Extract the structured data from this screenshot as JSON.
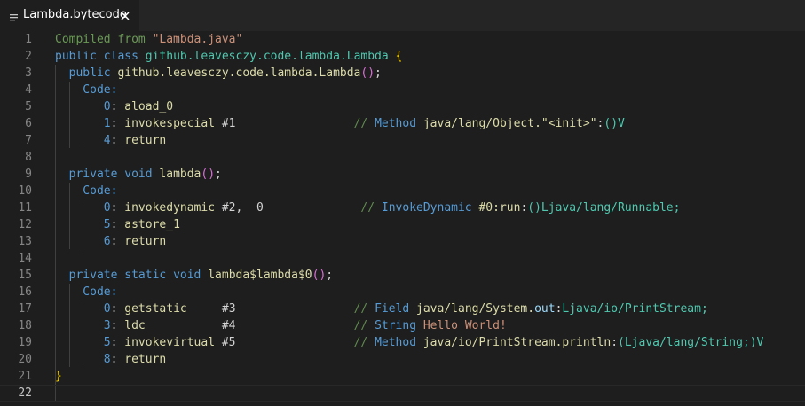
{
  "tab": {
    "title": "Lambda.bytecode",
    "icon": "lines-icon",
    "close": "close-icon"
  },
  "colors": {
    "background": "#1e1e1e",
    "tabbar": "#252526",
    "comment": "#6a9955",
    "string": "#ce9178",
    "keyword": "#569cd6",
    "type": "#4ec9b0",
    "function": "#dcdcaa",
    "bracket_gold": "#ffd700",
    "bracket_purple": "#da70d6"
  },
  "lines": [
    {
      "n": "1",
      "tokens": [
        {
          "t": "Compiled from ",
          "c": "c-comment"
        },
        {
          "t": "\"Lambda.java\"",
          "c": "c-str"
        }
      ]
    },
    {
      "n": "2",
      "tokens": [
        {
          "t": "public ",
          "c": "c-kw"
        },
        {
          "t": "class ",
          "c": "c-kw"
        },
        {
          "t": "github.leavesczy.code.lambda.Lambda",
          "c": "c-type"
        },
        {
          "t": " ",
          "c": "c-plain"
        },
        {
          "t": "{",
          "c": "c-br1"
        }
      ]
    },
    {
      "n": "3",
      "tokens": [
        {
          "t": "  public ",
          "c": "c-kw"
        },
        {
          "t": "github.leavesczy.code.lambda.Lambda",
          "c": "c-fn"
        },
        {
          "t": "(",
          "c": "c-br2"
        },
        {
          "t": ")",
          "c": "c-br2"
        },
        {
          "t": ";",
          "c": "c-plain"
        }
      ]
    },
    {
      "n": "4",
      "tokens": [
        {
          "t": "    Code:",
          "c": "c-kw"
        }
      ]
    },
    {
      "n": "5",
      "tokens": [
        {
          "t": "       0",
          "c": "c-kw"
        },
        {
          "t": ": ",
          "c": "c-plain"
        },
        {
          "t": "aload_0",
          "c": "c-fn"
        }
      ]
    },
    {
      "n": "6",
      "tokens": [
        {
          "t": "       1",
          "c": "c-kw"
        },
        {
          "t": ": ",
          "c": "c-plain"
        },
        {
          "t": "invokespecial",
          "c": "c-fn"
        },
        {
          "t": " #1                 ",
          "c": "c-plain"
        },
        {
          "t": "// ",
          "c": "c-lcom"
        },
        {
          "t": "Method",
          "c": "c-lcomkw"
        },
        {
          "t": " java/lang/Object.",
          "c": "c-fn"
        },
        {
          "t": "\"<init>\"",
          "c": "c-fn"
        },
        {
          "t": ":",
          "c": "c-plain"
        },
        {
          "t": "()V",
          "c": "c-type"
        }
      ]
    },
    {
      "n": "7",
      "tokens": [
        {
          "t": "       4",
          "c": "c-kw"
        },
        {
          "t": ": ",
          "c": "c-plain"
        },
        {
          "t": "return",
          "c": "c-fn"
        }
      ]
    },
    {
      "n": "8",
      "tokens": []
    },
    {
      "n": "9",
      "tokens": [
        {
          "t": "  private ",
          "c": "c-kw"
        },
        {
          "t": "void ",
          "c": "c-kw"
        },
        {
          "t": "lambda",
          "c": "c-fn"
        },
        {
          "t": "(",
          "c": "c-br2"
        },
        {
          "t": ")",
          "c": "c-br2"
        },
        {
          "t": ";",
          "c": "c-plain"
        }
      ]
    },
    {
      "n": "10",
      "tokens": [
        {
          "t": "    Code:",
          "c": "c-kw"
        }
      ]
    },
    {
      "n": "11",
      "tokens": [
        {
          "t": "       0",
          "c": "c-kw"
        },
        {
          "t": ": ",
          "c": "c-plain"
        },
        {
          "t": "invokedynamic",
          "c": "c-fn"
        },
        {
          "t": " #2,  0              ",
          "c": "c-plain"
        },
        {
          "t": "// ",
          "c": "c-lcom"
        },
        {
          "t": "InvokeDynamic",
          "c": "c-lcomkw"
        },
        {
          "t": " #0:",
          "c": "c-fn"
        },
        {
          "t": "run",
          "c": "c-fn"
        },
        {
          "t": ":",
          "c": "c-plain"
        },
        {
          "t": "()Ljava/lang/Runnable;",
          "c": "c-type"
        }
      ]
    },
    {
      "n": "12",
      "tokens": [
        {
          "t": "       5",
          "c": "c-kw"
        },
        {
          "t": ": ",
          "c": "c-plain"
        },
        {
          "t": "astore_1",
          "c": "c-fn"
        }
      ]
    },
    {
      "n": "13",
      "tokens": [
        {
          "t": "       6",
          "c": "c-kw"
        },
        {
          "t": ": ",
          "c": "c-plain"
        },
        {
          "t": "return",
          "c": "c-fn"
        }
      ]
    },
    {
      "n": "14",
      "tokens": []
    },
    {
      "n": "15",
      "tokens": [
        {
          "t": "  private ",
          "c": "c-kw"
        },
        {
          "t": "static ",
          "c": "c-kw"
        },
        {
          "t": "void ",
          "c": "c-kw"
        },
        {
          "t": "lambda$lambda$0",
          "c": "c-fn"
        },
        {
          "t": "(",
          "c": "c-br2"
        },
        {
          "t": ")",
          "c": "c-br2"
        },
        {
          "t": ";",
          "c": "c-plain"
        }
      ]
    },
    {
      "n": "16",
      "tokens": [
        {
          "t": "    Code:",
          "c": "c-kw"
        }
      ]
    },
    {
      "n": "17",
      "tokens": [
        {
          "t": "       0",
          "c": "c-kw"
        },
        {
          "t": ": ",
          "c": "c-plain"
        },
        {
          "t": "getstatic",
          "c": "c-fn"
        },
        {
          "t": "     #3                 ",
          "c": "c-plain"
        },
        {
          "t": "// ",
          "c": "c-lcom"
        },
        {
          "t": "Field",
          "c": "c-lcomkw"
        },
        {
          "t": " java/lang/System.",
          "c": "c-fn"
        },
        {
          "t": "out",
          "c": "c-lcomvar"
        },
        {
          "t": ":",
          "c": "c-plain"
        },
        {
          "t": "Ljava/io/PrintStream;",
          "c": "c-type"
        }
      ]
    },
    {
      "n": "18",
      "tokens": [
        {
          "t": "       3",
          "c": "c-kw"
        },
        {
          "t": ": ",
          "c": "c-plain"
        },
        {
          "t": "ldc",
          "c": "c-fn"
        },
        {
          "t": "           #4                 ",
          "c": "c-plain"
        },
        {
          "t": "// ",
          "c": "c-lcom"
        },
        {
          "t": "String",
          "c": "c-lcomkw"
        },
        {
          "t": " Hello World!",
          "c": "c-str"
        }
      ]
    },
    {
      "n": "19",
      "tokens": [
        {
          "t": "       5",
          "c": "c-kw"
        },
        {
          "t": ": ",
          "c": "c-plain"
        },
        {
          "t": "invokevirtual",
          "c": "c-fn"
        },
        {
          "t": " #5                 ",
          "c": "c-plain"
        },
        {
          "t": "// ",
          "c": "c-lcom"
        },
        {
          "t": "Method",
          "c": "c-lcomkw"
        },
        {
          "t": " java/io/PrintStream.println",
          "c": "c-fn"
        },
        {
          "t": ":",
          "c": "c-plain"
        },
        {
          "t": "(Ljava/lang/String;)V",
          "c": "c-type"
        }
      ]
    },
    {
      "n": "20",
      "tokens": [
        {
          "t": "       8",
          "c": "c-kw"
        },
        {
          "t": ": ",
          "c": "c-plain"
        },
        {
          "t": "return",
          "c": "c-fn"
        }
      ]
    },
    {
      "n": "21",
      "tokens": [
        {
          "t": "}",
          "c": "c-br1"
        }
      ]
    },
    {
      "n": "22",
      "tokens": []
    }
  ],
  "current_line": "22"
}
